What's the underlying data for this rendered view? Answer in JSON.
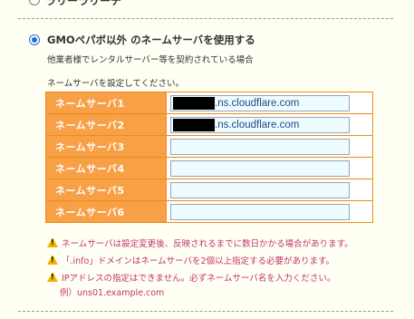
{
  "previous_option": {
    "label": "ラリーラリーチ"
  },
  "option": {
    "selected": true,
    "label": "GMOペパボ以外 のネームサーバを使用する",
    "description": "他業者様でレンタルサーバー等を契約されている場合"
  },
  "instruction": "ネームサーバを設定してください。",
  "nameservers": [
    {
      "label": "ネームサーバ1",
      "value": ".ns.cloudflare.com",
      "redacted": true
    },
    {
      "label": "ネームサーバ2",
      "value": ".ns.cloudflare.com",
      "redacted": true
    },
    {
      "label": "ネームサーバ3",
      "value": "",
      "redacted": false
    },
    {
      "label": "ネームサーバ4",
      "value": "",
      "redacted": false
    },
    {
      "label": "ネームサーバ5",
      "value": "",
      "redacted": false
    },
    {
      "label": "ネームサーバ6",
      "value": "",
      "redacted": false
    }
  ],
  "notes": [
    "ネームサーバは設定変更後、反映されるまでに数日かかる場合があります。",
    "「.info」ドメインはネームサーバを2個以上指定する必要があります。",
    "IPアドレスの指定はできません。必ずネームサーバ名を入力ください。"
  ],
  "example": "例）uns01.example.com",
  "colors": {
    "label_bg": "#f7a046",
    "border": "#f08a1a",
    "input_bg": "#eefcff",
    "note_text": "#c0366a",
    "radio_selected": "#1f6fd1"
  }
}
